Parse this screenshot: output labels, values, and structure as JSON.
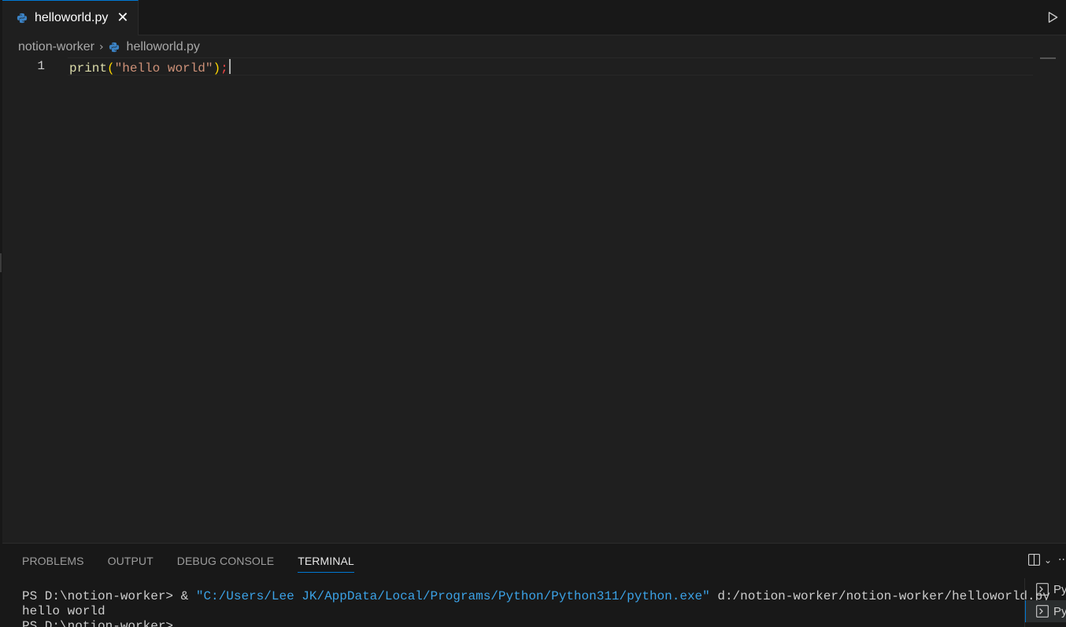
{
  "editor_tabs": [
    {
      "label": "helloworld.py",
      "icon": "python-icon",
      "active": true
    }
  ],
  "breadcrumb": {
    "folder": "notion-worker",
    "file": "helloworld.py"
  },
  "editor": {
    "line_numbers": [
      "1"
    ],
    "code": {
      "fn": "print",
      "open_paren": "(",
      "string": "\"hello world\"",
      "close_paren": ")",
      "semicolon": ";"
    }
  },
  "panel": {
    "tabs": [
      "PROBLEMS",
      "OUTPUT",
      "DEBUG CONSOLE",
      "TERMINAL"
    ],
    "active_tab": "TERMINAL"
  },
  "terminal": {
    "line1_prompt": "PS D:\\notion-worker> & ",
    "line1_exe": "\"C:/Users/Lee JK/AppData/Local/Programs/Python/Python311/python.exe\"",
    "line1_arg": " d:/notion-worker/notion-worker/helloworld.py",
    "line2": "hello world",
    "line3": "PS D:\\notion-worker> ",
    "instances": [
      "Py",
      "Py"
    ]
  },
  "colors": {
    "accent": "#0078d4",
    "background": "#1f1f1f",
    "function": "#dcdcaa",
    "string": "#ce9178",
    "error": "#f44747"
  }
}
